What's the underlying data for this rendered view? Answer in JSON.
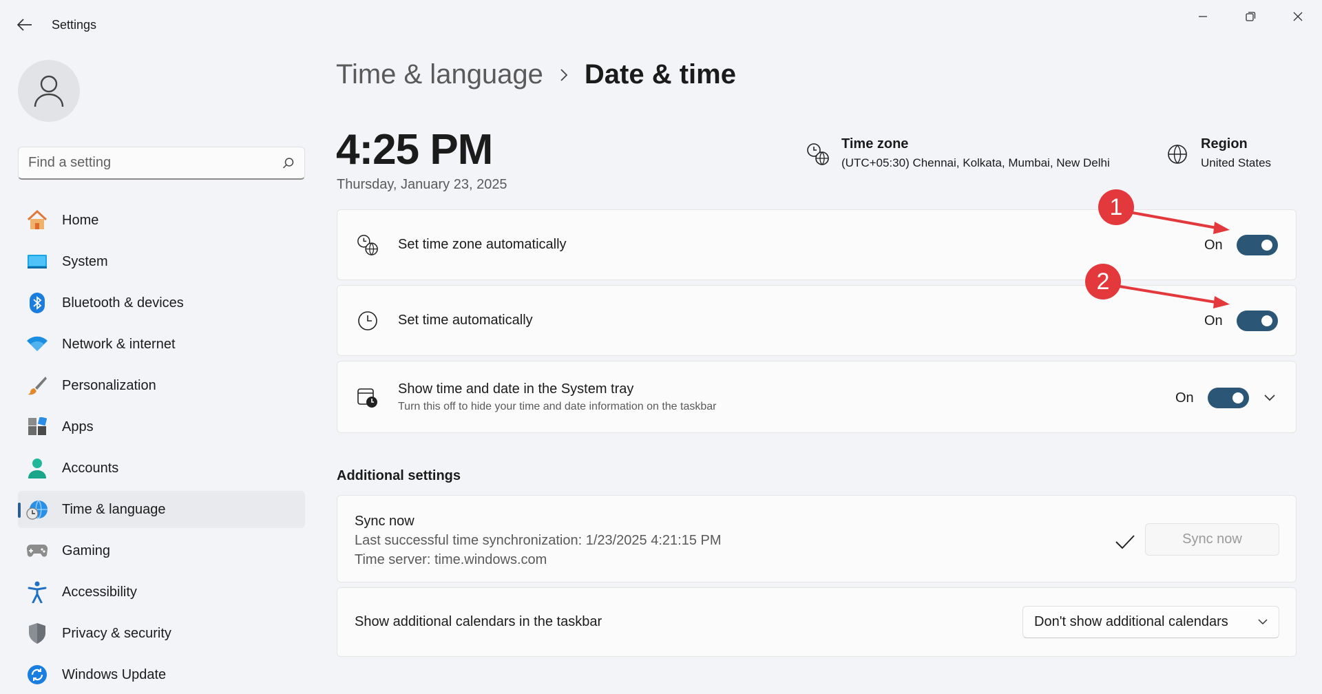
{
  "window": {
    "title": "Settings"
  },
  "sidebar": {
    "search_placeholder": "Find a setting",
    "items": [
      {
        "label": "Home",
        "icon": "home-icon"
      },
      {
        "label": "System",
        "icon": "system-icon"
      },
      {
        "label": "Bluetooth & devices",
        "icon": "bluetooth-icon"
      },
      {
        "label": "Network & internet",
        "icon": "wifi-icon"
      },
      {
        "label": "Personalization",
        "icon": "brush-icon"
      },
      {
        "label": "Apps",
        "icon": "apps-icon"
      },
      {
        "label": "Accounts",
        "icon": "account-icon"
      },
      {
        "label": "Time & language",
        "icon": "globe-clock-icon",
        "active": true
      },
      {
        "label": "Gaming",
        "icon": "gamepad-icon"
      },
      {
        "label": "Accessibility",
        "icon": "accessibility-icon"
      },
      {
        "label": "Privacy & security",
        "icon": "shield-icon"
      },
      {
        "label": "Windows Update",
        "icon": "update-icon"
      }
    ]
  },
  "header": {
    "parent": "Time & language",
    "current": "Date & time"
  },
  "clock": {
    "time": "4:25 PM",
    "date": "Thursday, January 23, 2025"
  },
  "timezone": {
    "title": "Time zone",
    "value": "(UTC+05:30) Chennai, Kolkata, Mumbai, New Delhi"
  },
  "region": {
    "title": "Region",
    "value": "United States"
  },
  "settings": {
    "tz_auto": {
      "label": "Set time zone automatically",
      "state": "On"
    },
    "time_auto": {
      "label": "Set time automatically",
      "state": "On"
    },
    "tray": {
      "label": "Show time and date in the System tray",
      "sub": "Turn this off to hide your time and date information on the taskbar",
      "state": "On"
    }
  },
  "additional": {
    "title": "Additional settings",
    "sync": {
      "title": "Sync now",
      "last_sync": "Last successful time synchronization: 1/23/2025 4:21:15 PM",
      "server": "Time server: time.windows.com",
      "button": "Sync now"
    },
    "calendars": {
      "label": "Show additional calendars in the taskbar",
      "selected": "Don't show additional calendars"
    }
  },
  "annotations": {
    "badge1": "1",
    "badge2": "2",
    "color": "#e4393c"
  },
  "colors": {
    "accent": "#2c5676",
    "background": "#f3f4f8"
  }
}
